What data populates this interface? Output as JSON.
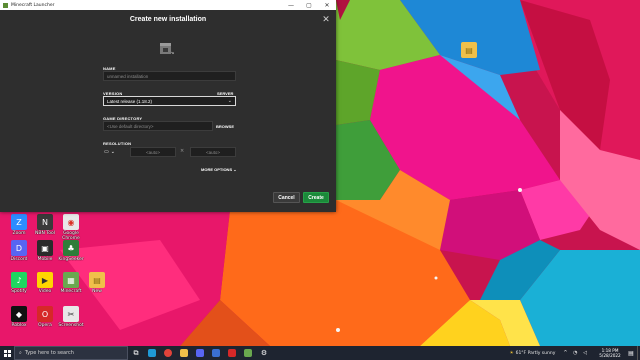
{
  "window": {
    "title": "Minecraft Launcher",
    "min_glyph": "—",
    "max_glyph": "▢",
    "close_glyph": "✕"
  },
  "dialog": {
    "title": "Create new installation",
    "close_glyph": "✕",
    "name_label": "NAME",
    "name_placeholder": "unnamed installation",
    "version_label": "VERSION",
    "server_label": "SERVER",
    "version_value": "Latest release (1.18.2)",
    "game_dir_label": "GAME DIRECTORY",
    "game_dir_placeholder": "<Use default directory>",
    "browse_label": "BROWSE",
    "resolution_label": "RESOLUTION",
    "width_placeholder": "<auto>",
    "height_placeholder": "<auto>",
    "times_glyph": "×",
    "more_options_label": "MORE OPTIONS",
    "cancel_label": "Cancel",
    "create_label": "Create"
  },
  "desktop_icons": [
    {
      "label": "Zoom",
      "color": "#2d8cff",
      "glyph": "Z"
    },
    {
      "label": "NBN Tool",
      "color": "#3a3a3a",
      "glyph": "N"
    },
    {
      "label": "Google Chrome",
      "color": "#e8e8e8",
      "glyph": "◉"
    },
    {
      "label": "Discord",
      "color": "#5865f2",
      "glyph": "D"
    },
    {
      "label": "Mobile",
      "color": "#2b2b2b",
      "glyph": "▣"
    },
    {
      "label": "KingSeeker",
      "color": "#2f7d3a",
      "glyph": "♣"
    },
    {
      "label": "Spotify",
      "color": "#1ed760",
      "glyph": "♪"
    },
    {
      "label": "Video",
      "color": "#ffd600",
      "glyph": "▶"
    },
    {
      "label": "Minecraft",
      "color": "#6aa84f",
      "glyph": "▦"
    },
    {
      "label": "New",
      "color": "#f0c04a",
      "glyph": "▤"
    },
    {
      "label": "Roblox",
      "color": "#111111",
      "glyph": "◆"
    },
    {
      "label": "Opera",
      "color": "#d62828",
      "glyph": "O"
    },
    {
      "label": "Screenshot",
      "color": "#e8e8e8",
      "glyph": "✂"
    },
    {
      "label": "Folder",
      "color": "#f0c04a",
      "glyph": "▤"
    }
  ],
  "taskbar": {
    "search_placeholder": "Type here to search",
    "weather": "61°F  Partly sunny",
    "time": "1:18 PM",
    "date": "5/28/2022"
  }
}
